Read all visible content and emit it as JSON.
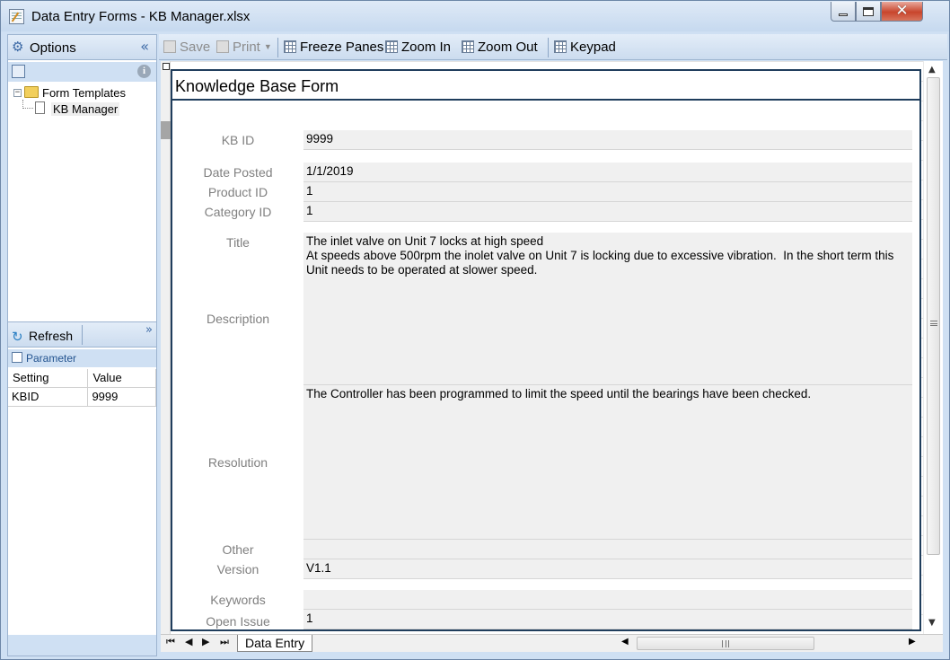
{
  "window": {
    "title": "Data Entry Forms - KB Manager.xlsx",
    "close_glyph": "✕"
  },
  "sidebar": {
    "options_label": "Options",
    "collapse_glyph": "«",
    "info_glyph": "i",
    "tree": {
      "folder_label": "Form Templates",
      "item_label": "KB Manager",
      "expander_glyph": "−"
    },
    "refresh_label": "Refresh",
    "expand_glyph": "»",
    "parameter_label": "Parameter",
    "param_table": {
      "headers": [
        "Setting",
        "Value"
      ],
      "rows": [
        [
          "KBID",
          "9999"
        ]
      ]
    }
  },
  "toolbar": {
    "save_label": "Save",
    "print_label": "Print",
    "freeze_label": "Freeze Panes",
    "zoom_in_label": "Zoom In",
    "zoom_out_label": "Zoom Out",
    "keypad_label": "Keypad"
  },
  "form": {
    "title": "Knowledge Base Form",
    "fields": [
      {
        "label": "KB ID",
        "value": "9999"
      },
      {
        "label": "Date Posted",
        "value": "1/1/2019"
      },
      {
        "label": "Product ID",
        "value": "1"
      },
      {
        "label": "Category ID",
        "value": "1"
      },
      {
        "label": "Title",
        "value": "The inlet valve on Unit 7 locks at high speed"
      },
      {
        "label": "Description",
        "value": "At speeds above 500rpm the inolet valve on Unit 7 is locking due to excessive vibration.  In the short term this Unit needs to be operated at slower speed."
      },
      {
        "label": "Resolution",
        "value": "The Controller has been programmed to limit the speed until the bearings have been checked."
      },
      {
        "label": "Other",
        "value": ""
      },
      {
        "label": "Version",
        "value": "V1.1"
      },
      {
        "label": "Keywords",
        "value": ""
      },
      {
        "label": "Open Issue",
        "value": "1"
      }
    ]
  },
  "sheet_tabs": {
    "active": "Data Entry",
    "nav": [
      "⏮",
      "◀",
      "▶",
      "⏭"
    ]
  },
  "icons": {
    "gear": "⚙",
    "refresh": "↻",
    "scroll_up": "▲",
    "scroll_down": "▼",
    "scroll_left": "◀",
    "scroll_right": "▶"
  }
}
